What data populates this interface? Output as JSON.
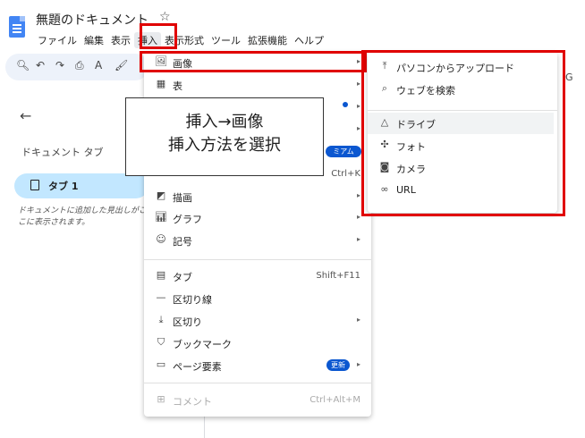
{
  "header": {
    "title": "無題のドキュメント",
    "star": "☆",
    "menu": [
      "ファイル",
      "編集",
      "表示",
      "挿入",
      "表示形式",
      "ツール",
      "拡張機能",
      "ヘルプ"
    ]
  },
  "toolbar": {
    "icons": [
      "search-icon",
      "undo-icon",
      "redo-icon",
      "print-icon",
      "spellcheck-icon",
      "paint-format-icon"
    ]
  },
  "left_panel": {
    "heading": "ドキュメント タブ",
    "tab_label": "タブ 1",
    "hint": "ドキュメントに追加した見出しがここに表示されます。"
  },
  "insert_menu": {
    "items": [
      {
        "label": "画像",
        "arrow": "▸"
      },
      {
        "label": "表",
        "arrow": "▸"
      },
      {
        "label": "",
        "arrow": "▸"
      },
      {
        "label": "",
        "arrow": "▸"
      },
      {
        "label": "",
        "arrow": ""
      },
      {
        "label": "",
        "shortcut": "Ctrl+K"
      },
      {
        "label": "描画",
        "arrow": "▸"
      },
      {
        "label": "グラフ",
        "arrow": "▸"
      },
      {
        "label": "記号",
        "arrow": "▸"
      },
      {
        "label": "タブ",
        "shortcut": "Shift+F11"
      },
      {
        "label": "区切り線"
      },
      {
        "label": "区切り",
        "arrow": "▸"
      },
      {
        "label": "ブックマーク"
      },
      {
        "label": "ページ要素",
        "badge": "更新",
        "arrow": "▸"
      },
      {
        "label": "コメント",
        "shortcut": "Ctrl+Alt+M"
      }
    ],
    "premium_badge": "ミアム"
  },
  "annotation": {
    "line1": "挿入→画像",
    "line2": "挿入方法を選択"
  },
  "image_submenu": {
    "items": [
      {
        "label": "パソコンからアップロード",
        "icon": "upload-icon"
      },
      {
        "label": "ウェブを検索",
        "icon": "search-icon"
      },
      {
        "label": "ドライブ",
        "icon": "drive-icon"
      },
      {
        "label": "フォト",
        "icon": "photos-icon"
      },
      {
        "label": "カメラ",
        "icon": "camera-icon"
      },
      {
        "label": "URL",
        "icon": "link-icon"
      }
    ]
  },
  "colors": {
    "accent": "#0b57d0",
    "highlight": "#e00000",
    "chip": "#c2e7ff"
  }
}
